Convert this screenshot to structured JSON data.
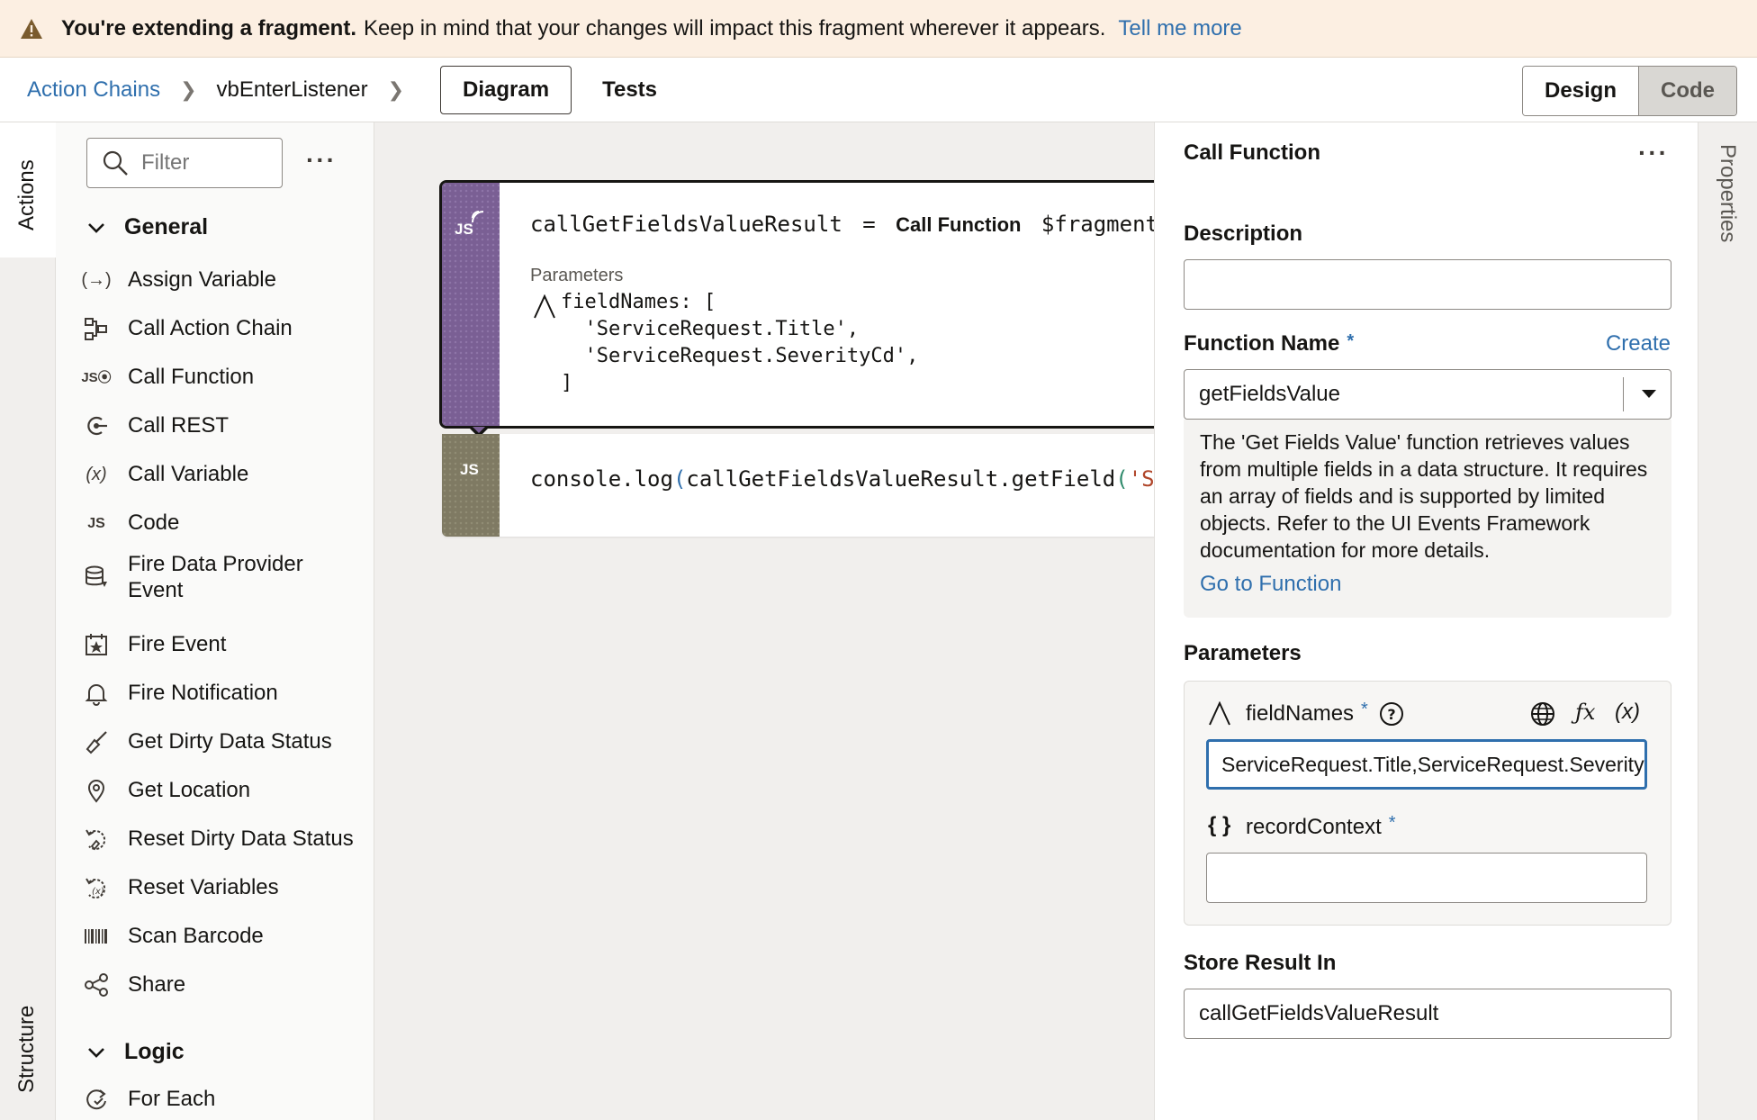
{
  "banner": {
    "bold": "You're extending a fragment.",
    "message": "Keep in mind that your changes will impact this fragment wherever it appears.",
    "link": "Tell me more"
  },
  "toolbar": {
    "breadcrumb_root": "Action Chains",
    "breadcrumb_chain": "vbEnterListener",
    "tab_diagram": "Diagram",
    "tab_tests": "Tests",
    "design": "Design",
    "code": "Code"
  },
  "left_tabs": {
    "actions": "Actions",
    "structure": "Structure"
  },
  "actions_panel": {
    "filter_placeholder": "Filter",
    "more": "···",
    "section_general": "General",
    "general_items": [
      {
        "label": "Assign Variable",
        "icon": "assign-variable-icon"
      },
      {
        "label": "Call Action Chain",
        "icon": "call-action-chain-icon"
      },
      {
        "label": "Call Function",
        "icon": "call-function-icon"
      },
      {
        "label": "Call REST",
        "icon": "call-rest-icon"
      },
      {
        "label": "Call Variable",
        "icon": "call-variable-icon"
      },
      {
        "label": "Code",
        "icon": "code-icon"
      },
      {
        "label": "Fire Data Provider",
        "label2": "Event",
        "icon": "fire-data-provider-icon"
      },
      {
        "label": "Fire Event",
        "icon": "fire-event-icon"
      },
      {
        "label": "Fire Notification",
        "icon": "bell-icon"
      },
      {
        "label": "Get Dirty Data Status",
        "icon": "broom-icon"
      },
      {
        "label": "Get Location",
        "icon": "location-pin-icon"
      },
      {
        "label": "Reset Dirty Data Status",
        "icon": "reset-dirty-icon"
      },
      {
        "label": "Reset Variables",
        "icon": "reset-variables-icon"
      },
      {
        "label": "Scan Barcode",
        "icon": "barcode-icon"
      },
      {
        "label": "Share",
        "icon": "share-icon"
      }
    ],
    "section_logic": "Logic",
    "logic_items": [
      {
        "label": "For Each",
        "icon": "for-each-icon"
      }
    ]
  },
  "canvas": {
    "node1": {
      "badge": "JS",
      "assign": "callGetFieldsValueResult",
      "equals": "=",
      "keyword": "Call Function",
      "target": "$fragment.m",
      "params_label": "Parameters",
      "param_line1": "fieldNames: [",
      "param_line2": "  'ServiceRequest.Title',",
      "param_line3": "  'ServiceRequest.SeverityCd',",
      "param_line4": "]"
    },
    "node2": {
      "badge": "JS",
      "code_a": "console.log",
      "code_b": "(",
      "code_c": "callGetFieldsValueResult.getField",
      "code_d": "(",
      "code_e": "'S"
    }
  },
  "properties": {
    "title": "Call Function",
    "more": "···",
    "description_label": "Description",
    "description_value": "",
    "function_name_label": "Function Name",
    "required": "*",
    "create_link": "Create",
    "function_name_value": "getFieldsValue",
    "function_description": "The 'Get Fields Value' function retrieves values from multiple fields in a data structure. It requires an array of fields and is supported by limited objects. Refer to the UI Events Framework documentation for more details.",
    "go_to_function": "Go to Function",
    "parameters_label": "Parameters",
    "param1_name": "fieldNames",
    "param1_value": "ServiceRequest.Title,ServiceRequest.SeverityCd",
    "fx": "ƒx",
    "var": "(x)",
    "param2_name": "recordContext",
    "param2_icon": "{ }",
    "param2_value": "",
    "store_result_label": "Store Result In",
    "store_result_value": "callGetFieldsValueResult"
  },
  "right_tab": {
    "properties": "Properties"
  },
  "colors": {
    "accent": "#2f6fad",
    "banner_bg": "#fcefe2",
    "function_node": "#7a5f94",
    "code_node": "#7f7a63"
  }
}
